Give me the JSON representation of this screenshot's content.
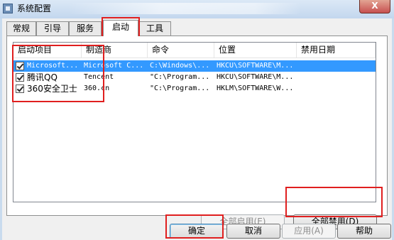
{
  "window": {
    "title": "系统配置",
    "close_label": "X"
  },
  "tabs": [
    {
      "label": "常规"
    },
    {
      "label": "引导"
    },
    {
      "label": "服务"
    },
    {
      "label": "启动"
    },
    {
      "label": "工具"
    }
  ],
  "startup_list": {
    "columns": [
      "启动项目",
      "制造商",
      "命令",
      "位置",
      "禁用日期"
    ],
    "rows": [
      {
        "item": "Microsoft...",
        "maker": "Microsoft C...",
        "command": "C:\\Windows\\...",
        "location": "HKCU\\SOFTWARE\\M...",
        "date": "",
        "checked": true,
        "selected": true
      },
      {
        "item": "腾讯QQ",
        "maker": "Tencent",
        "command": "\"C:\\Program...",
        "location": "HKCU\\SOFTWARE\\M...",
        "date": "",
        "checked": true,
        "selected": false
      },
      {
        "item": "360安全卫士",
        "maker": "360.cn",
        "command": "\"C:\\Program...",
        "location": "HKLM\\SOFTWARE\\W...",
        "date": "",
        "checked": true,
        "selected": false
      }
    ]
  },
  "buttons": {
    "enable_all": "全部启用(E)",
    "disable_all": "全部禁用(D)",
    "ok": "确定",
    "cancel": "取消",
    "apply": "应用(A)",
    "help": "帮助"
  },
  "colors": {
    "selection": "#3399ff",
    "highlight_box": "#e01f1f"
  }
}
